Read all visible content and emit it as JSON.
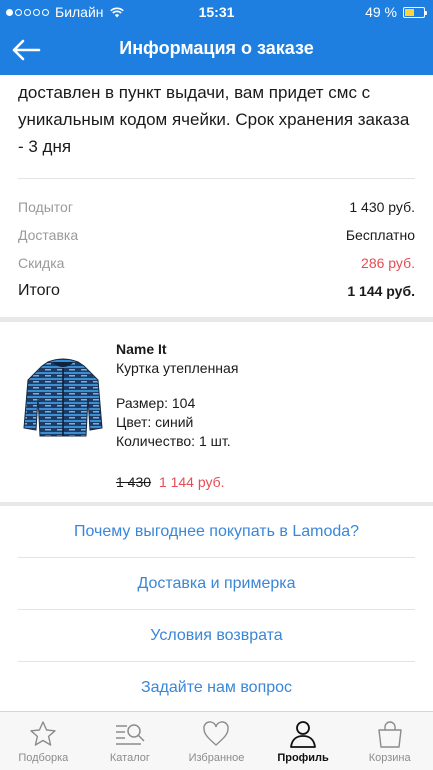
{
  "status_bar": {
    "carrier": "Билайн",
    "time": "15:31",
    "battery": "49 %",
    "battery_level": 0.49,
    "signal_bars_filled": 1,
    "signal_bars_total": 5
  },
  "header": {
    "title": "Информация о заказе",
    "back_icon": "arrow-left-icon"
  },
  "delivery_note": "доставлен в пункт выдачи, вам придет смс с уникальным кодом ячейки. Срок хранения заказа - 3 дня",
  "summary": {
    "subtotal_label": "Подытог",
    "subtotal_value": "1 430 руб.",
    "delivery_label": "Доставка",
    "delivery_value": "Бесплатно",
    "discount_label": "Скидка",
    "discount_value": "286 руб.",
    "total_label": "Итого",
    "total_value": "1 144 руб."
  },
  "product": {
    "brand": "Name It",
    "name": "Куртка утепленная",
    "size": "Размер: 104",
    "color": "Цвет: синий",
    "quantity": "Количество: 1 шт.",
    "old_price": "1 430",
    "new_price": "1 144 руб."
  },
  "links": [
    "Почему выгоднее покупать в Lamoda?",
    "Доставка и примерка",
    "Условия возврата",
    "Задайте нам вопрос"
  ],
  "tabbar": [
    {
      "label": "Подборка",
      "icon": "star-icon",
      "active": false
    },
    {
      "label": "Каталог",
      "icon": "catalog-search-icon",
      "active": false
    },
    {
      "label": "Избранное",
      "icon": "heart-icon",
      "active": false
    },
    {
      "label": "Профиль",
      "icon": "profile-icon",
      "active": true
    },
    {
      "label": "Корзина",
      "icon": "cart-bag-icon",
      "active": false
    }
  ],
  "colors": {
    "header_bg": "#1e7fe0",
    "link": "#3a86d8",
    "price_red": "#e74c55"
  }
}
